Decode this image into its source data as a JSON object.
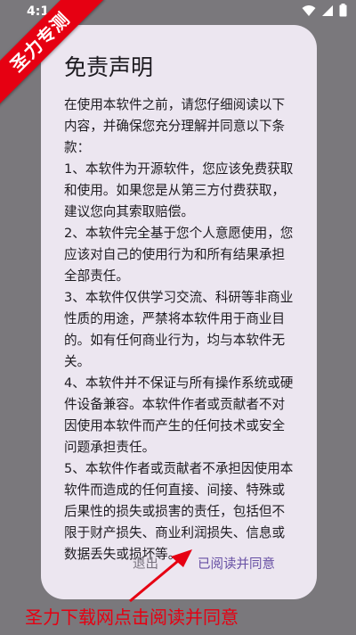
{
  "status_bar": {
    "time": "4:1"
  },
  "watermark": {
    "text": "圣力专测"
  },
  "dialog": {
    "title": "免责声明",
    "paragraphs": [
      "在使用本软件之前，请您仔细阅读以下内容，并确保您充分理解并同意以下条款：",
      "1、本软件为开源软件，您应该免费获取和使用。如果您是从第三方付费获取，建议您向其索取赔偿。",
      "2、本软件完全基于您个人意愿使用，您应该对自己的使用行为和所有结果承担全部责任。",
      "3、本软件仅供学习交流、科研等非商业性质的用途，严禁将本软件用于商业目的。如有任何商业行为，均与本软件无关。",
      "4、本软件并不保证与所有操作系统或硬件设备兼容。本软件作者或贡献者不对因使用本软件而产生的任何技术或安全问题承担责任。",
      "5、本软件作者或贡献者不承担因使用本软件而造成的任何直接、间接、特殊或后果性的损失或损害的责任，包括但不限于财产损失、商业利润损失、信息或数据丢失或损坏等。"
    ],
    "exit_label": "退出",
    "agree_label": "已阅读并同意"
  },
  "annotation": {
    "caption": "圣力下载网点击阅读并同意"
  },
  "colors": {
    "accent": "#6750a4",
    "dialog_bg": "#ece6f0",
    "scrim": "#7a787c",
    "annotation_red": "#e60012"
  }
}
